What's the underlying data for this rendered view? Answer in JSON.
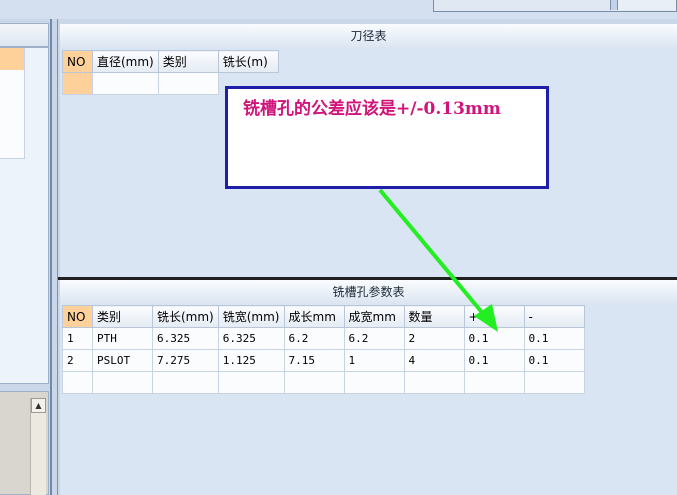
{
  "colors": {
    "annotation_text": "#d0147a",
    "annotation_border": "#1e1ea8",
    "arrow": "#22ee22",
    "selected_row": "#ffd19a"
  },
  "tool_panel": {
    "title": "刀径表",
    "columns": [
      "NO",
      "直径(mm)",
      "类别",
      "铣长(m)"
    ]
  },
  "slot_panel": {
    "title": "铣槽孔参数表",
    "columns": [
      "NO",
      "类别",
      "铣长(mm)",
      "铣宽(mm)",
      "成长mm",
      "成宽mm",
      "数量",
      "+",
      "-"
    ],
    "rows": [
      [
        "1",
        "PTH",
        "6.325",
        "6.325",
        "6.2",
        "6.2",
        "2",
        "0.1",
        "0.1"
      ],
      [
        "2",
        "PSLOT",
        "7.275",
        "1.125",
        "7.15",
        "1",
        "4",
        "0.1",
        "0.1"
      ]
    ]
  },
  "annotation": {
    "text": "铣槽孔的公差应该是+/-0.13mm"
  },
  "left_panel": {
    "scroll_up_icon": "arrow-up-icon"
  }
}
